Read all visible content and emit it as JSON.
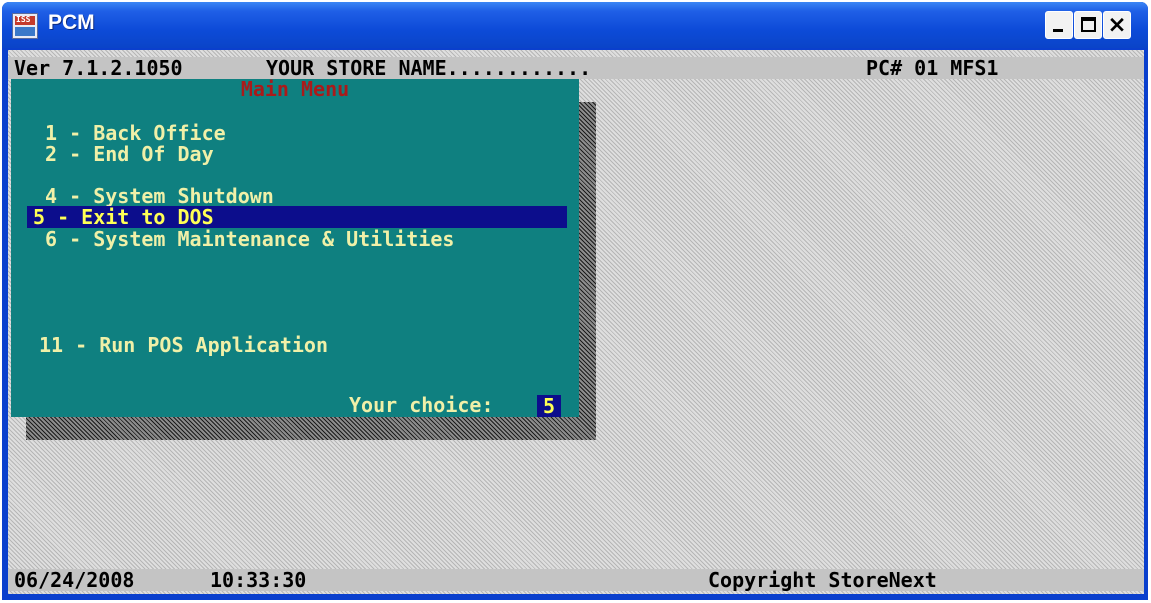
{
  "window": {
    "title": "PCM",
    "icon": "pcm-app-icon",
    "controls": [
      "minimize-icon",
      "maximize-icon",
      "close-icon"
    ],
    "close_glyph": "×"
  },
  "status_top": {
    "version": "Ver 7.1.2.1050",
    "store_name": "YOUR STORE NAME............",
    "pc_id": "PC# 01 MFS1"
  },
  "menu": {
    "title": "Main Menu",
    "items": [
      {
        "key": "1",
        "label": " 1 - Back Office"
      },
      {
        "key": "2",
        "label": " 2 - End Of Day"
      },
      {
        "key": "4",
        "label": " 4 - System Shutdown"
      },
      {
        "key": "5",
        "label": "5 - Exit to DOS",
        "selected": true
      },
      {
        "key": "6",
        "label": " 6 - System Maintenance & Utilities"
      },
      {
        "key": "11",
        "label": "11 - Run POS Application"
      }
    ],
    "choice_label": "Your choice:",
    "choice_value": "5"
  },
  "status_bottom": {
    "date": "06/24/2008",
    "time": "10:33:30",
    "copyright": "Copyright StoreNext"
  },
  "colors": {
    "menu_background": "#0f8080",
    "menu_title": "#aa1a1a",
    "menu_text": "#f0f0a8",
    "selection_background": "#0c0d8c",
    "selection_text": "#ffff55",
    "titlebar": "#0d4bd8"
  }
}
